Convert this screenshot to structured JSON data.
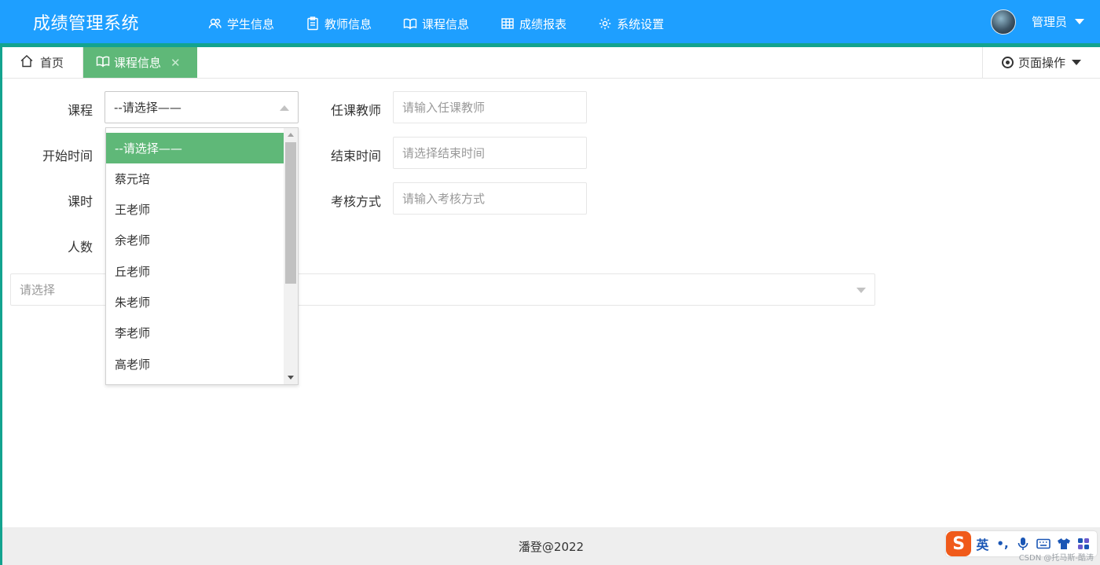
{
  "header": {
    "logo": "成绩管理系统",
    "nav": [
      {
        "label": "学生信息",
        "icon": "users-icon"
      },
      {
        "label": "教师信息",
        "icon": "clipboard-icon"
      },
      {
        "label": "课程信息",
        "icon": "book-icon",
        "active": true
      },
      {
        "label": "成绩报表",
        "icon": "table-icon"
      },
      {
        "label": "系统设置",
        "icon": "gear-icon"
      }
    ],
    "user": {
      "name": "管理员"
    }
  },
  "tabs": {
    "home": "首页",
    "course": "课程信息",
    "page_ops": "页面操作"
  },
  "form": {
    "course": {
      "label": "课程",
      "value": "--请选择——"
    },
    "teacher": {
      "label": "任课教师",
      "placeholder": "请输入任课教师"
    },
    "start": {
      "label": "开始时间"
    },
    "end": {
      "label": "结束时间",
      "placeholder": "请选择结束时间"
    },
    "hours": {
      "label": "课时"
    },
    "exam": {
      "label": "考核方式",
      "placeholder": "请输入考核方式"
    },
    "count": {
      "label": "人数"
    },
    "wide_select": {
      "placeholder": "请选择"
    }
  },
  "dropdown": {
    "options": [
      "--请选择——",
      "蔡元培",
      "王老师",
      "余老师",
      "丘老师",
      "朱老师",
      "李老师",
      "高老师"
    ],
    "selected_index": 0
  },
  "footer": {
    "text": "潘登@2022"
  },
  "ime": {
    "logo": "S",
    "lang": "英",
    "punct": "•,"
  },
  "watermark": "CSDN @托马斯-酷涛",
  "colors": {
    "header": "#1e9fff",
    "accent_green": "#5fb878",
    "teal_strip": "#13a38f"
  }
}
